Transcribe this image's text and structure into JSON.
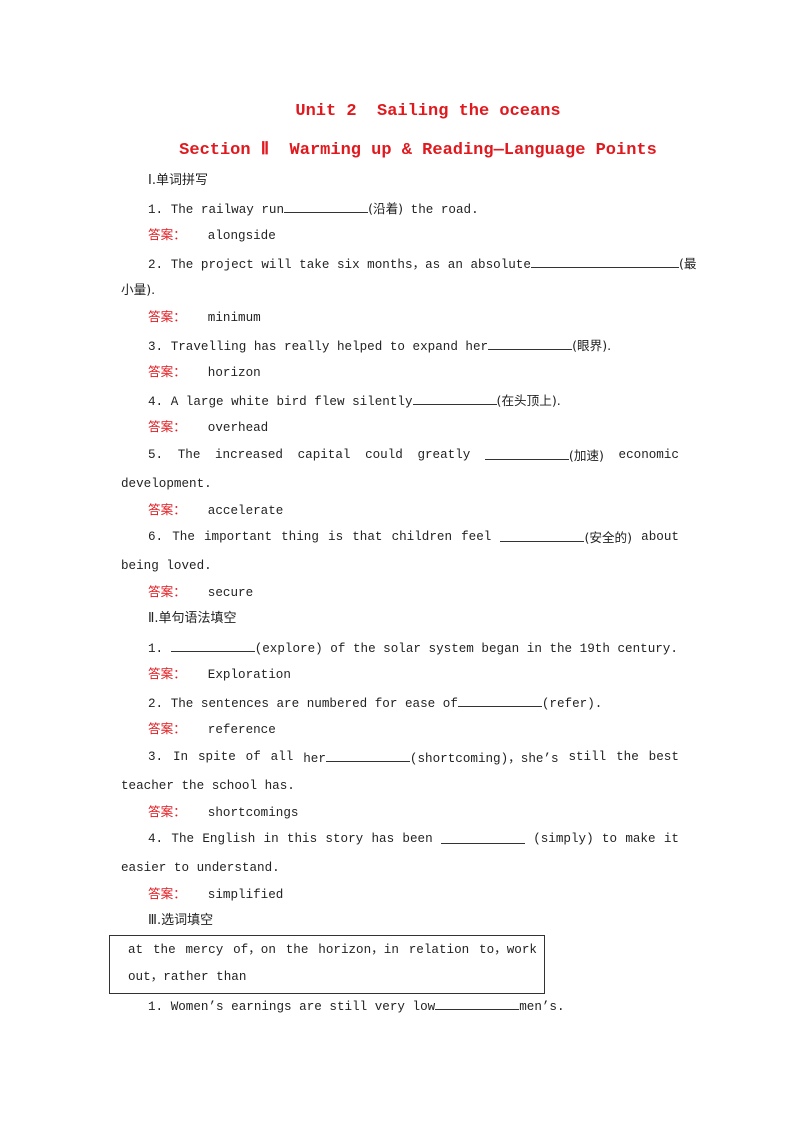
{
  "document": {
    "title": "Unit 2  Sailing the oceans",
    "subtitle": "Section Ⅱ  Warming up & Reading—Language Points",
    "answer_label": "答案：",
    "sections": [
      {
        "heading": "Ⅰ.单词拼写",
        "items": [
          {
            "num": "1.",
            "before": "The railway run",
            "hint": "(沿着)",
            "after": " the road.",
            "answer": "alongside"
          },
          {
            "num": "2.",
            "before": "The project will take six months，as an absolute",
            "hint": "(最",
            "cont": "小量).",
            "answer": "minimum"
          },
          {
            "num": "3.",
            "before": "Travelling has really helped to expand her",
            "hint": "(眼界).",
            "answer": "horizon"
          },
          {
            "num": "4.",
            "before": "A large white bird flew silently",
            "hint": "(在头顶上).",
            "answer": "overhead"
          },
          {
            "num": "5.",
            "words": [
              "5.",
              "The",
              "increased",
              "capital",
              "could",
              "greatly"
            ],
            "hint": "(加速)",
            "after": "economic",
            "cont": "development.",
            "answer": "accelerate"
          },
          {
            "num": "6.",
            "words": [
              "6.",
              "The",
              "important",
              "thing",
              "is",
              "that",
              "children",
              "feel"
            ],
            "hint": "(安全的)",
            "after": "about",
            "cont": "being loved.",
            "answer": "secure"
          }
        ]
      },
      {
        "heading": "Ⅱ.单句语法填空",
        "items": [
          {
            "num": "1.",
            "hint": "(explore)",
            "after": " of the solar system began in the 19th century.",
            "answer": "Exploration"
          },
          {
            "num": "2.",
            "before": "The sentences are numbered for ease of",
            "hint": "(refer).",
            "answer": "reference"
          },
          {
            "num": "3.",
            "words": [
              "3.",
              "In",
              "spite",
              "of",
              "all"
            ],
            "before": "her",
            "hint": "(shortcoming)，she’s",
            "after_words": [
              "still",
              "the",
              "best"
            ],
            "cont": "teacher the school has.",
            "answer": "shortcomings"
          },
          {
            "num": "4.",
            "words": [
              "4.",
              "The",
              "English",
              "in",
              "this",
              "story",
              "has",
              "been"
            ],
            "hint": "(simply)",
            "after_words": [
              "to",
              "make",
              "it"
            ],
            "cont": "easier to understand.",
            "answer": "simplified"
          }
        ]
      },
      {
        "heading": "Ⅲ.选词填空",
        "word_box": {
          "line1_words": [
            "at",
            "the",
            "mercy",
            "of，on",
            "the",
            "horizon，in",
            "relation",
            "to，work"
          ],
          "line2": "out，rather than"
        },
        "items": [
          {
            "num": "1.",
            "before": "Women’s earnings are still very low",
            "after": "men’s."
          }
        ]
      }
    ]
  }
}
